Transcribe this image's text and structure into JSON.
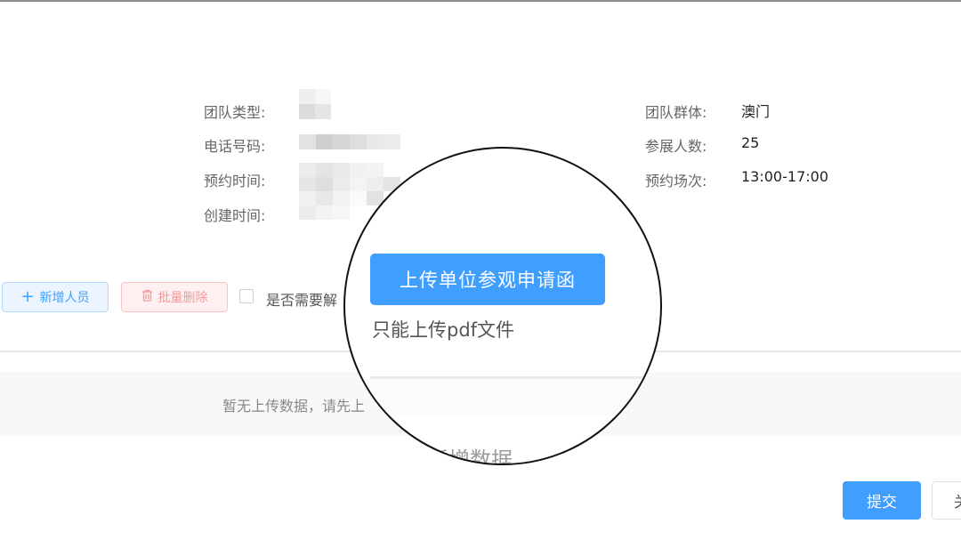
{
  "info": {
    "team_type_label": "团队类型:",
    "phone_label": "电话号码:",
    "reserve_time_label": "预约时间:",
    "create_time_label": "创建时间:",
    "team_group_label": "团队群体:",
    "team_group_value": "澳门",
    "attendees_label": "参展人数:",
    "attendees_value": "25",
    "session_label": "预约场次:",
    "session_value": "13:00-17:00"
  },
  "toolbar": {
    "add_label": "新增人员",
    "batch_delete_label": "批量删除",
    "checkbox_label": "是否需要解"
  },
  "table": {
    "empty_text": "暂无上传数据，请先上"
  },
  "magnifier": {
    "upload_button": "上传单位参观申请函",
    "upload_tip": "只能上传pdf文件",
    "ghost_text": "新增数据"
  },
  "footer": {
    "submit_label": "提交",
    "close_label": "关"
  },
  "colors": {
    "primary": "#409eff",
    "danger_light": "#fef0f0"
  }
}
